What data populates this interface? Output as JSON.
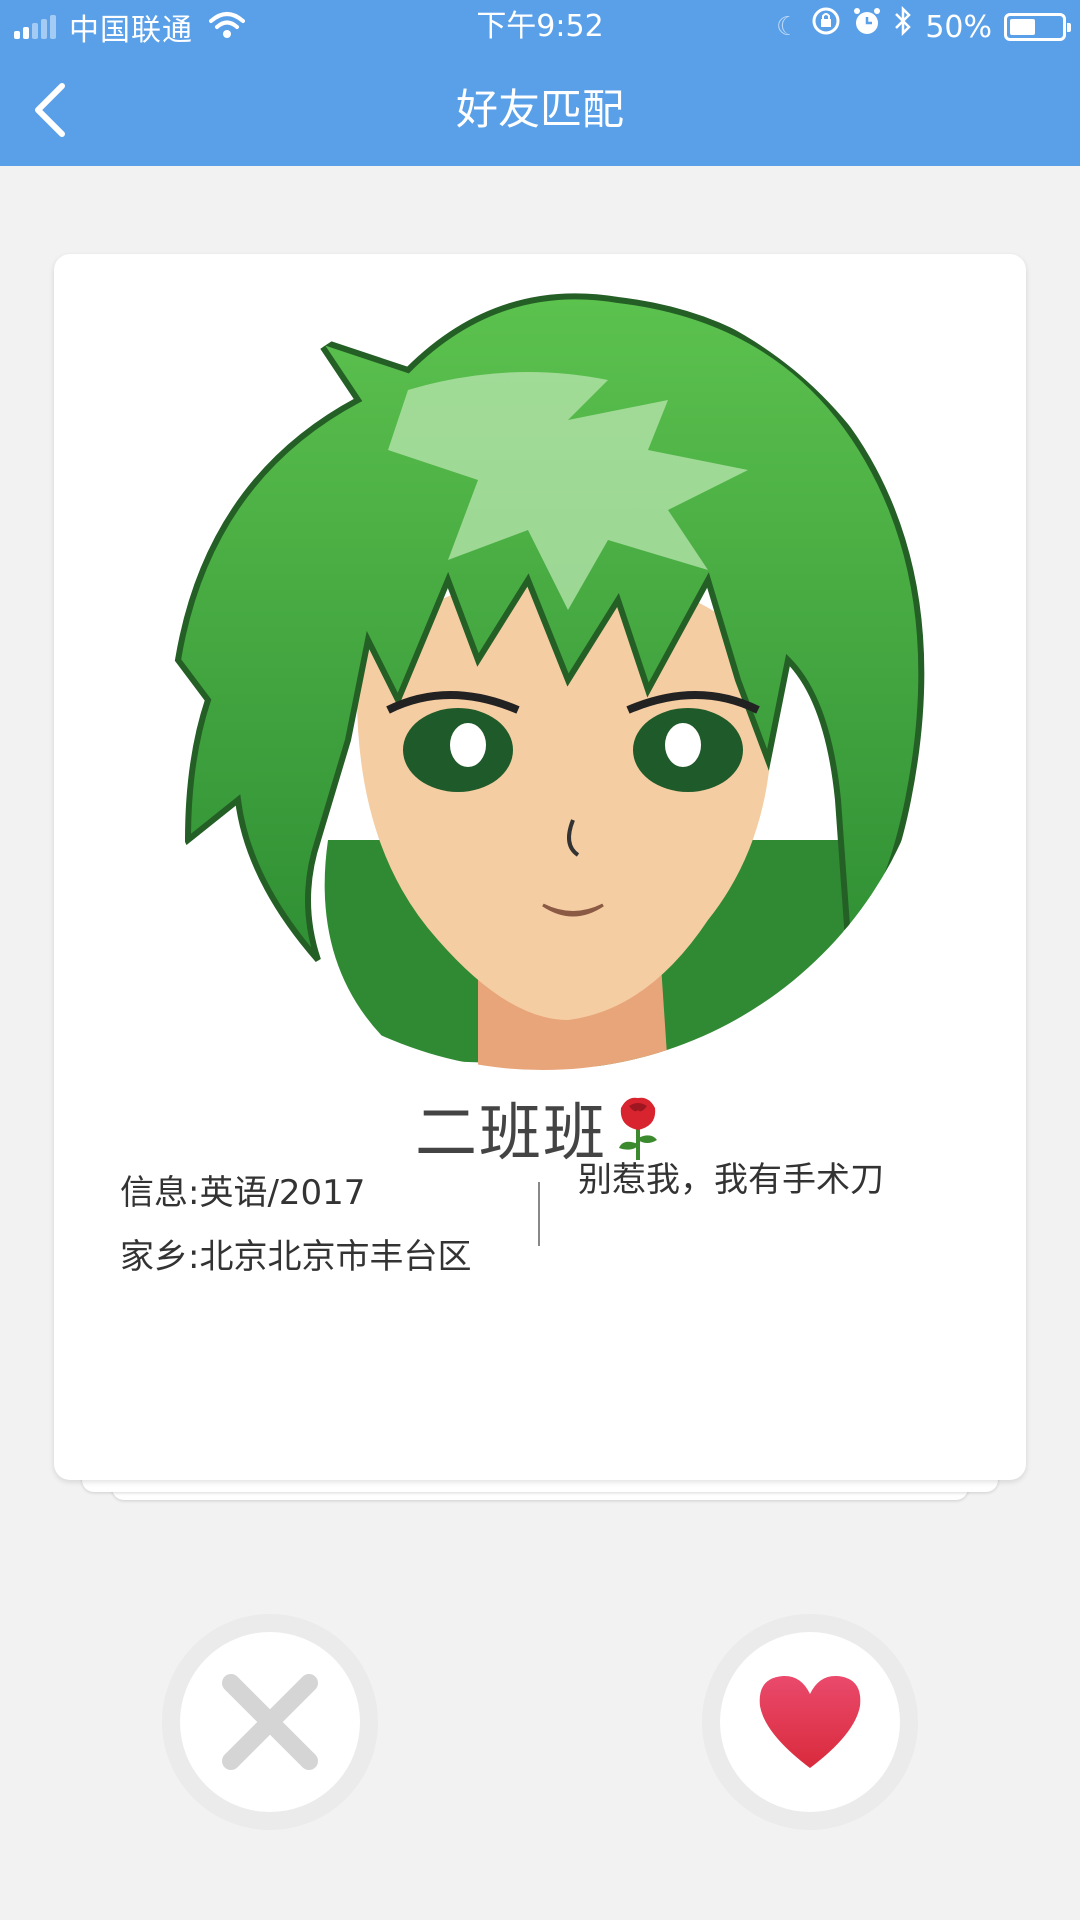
{
  "status_bar": {
    "carrier": "中国联通",
    "time": "下午9:52",
    "battery_percent": "50%",
    "battery_level": 0.5,
    "icons": [
      "signal-icon",
      "wifi-icon",
      "moon-icon",
      "rotation-lock-icon",
      "alarm-icon",
      "bluetooth-icon",
      "battery-icon"
    ]
  },
  "header": {
    "title": "好友匹配",
    "background_color": "#5aa0e9"
  },
  "card": {
    "name": "二班班",
    "info": "信息:英语/2017",
    "hometown": "家乡:北京北京市丰台区",
    "signature": "别惹我，我有手术刀",
    "icons": [
      "avatar-image",
      "rose-icon"
    ]
  },
  "actions": {
    "reject_icon": "close-icon",
    "like_icon": "heart-icon",
    "like_color": "#e0304a",
    "reject_color": "#d5d5d5"
  }
}
